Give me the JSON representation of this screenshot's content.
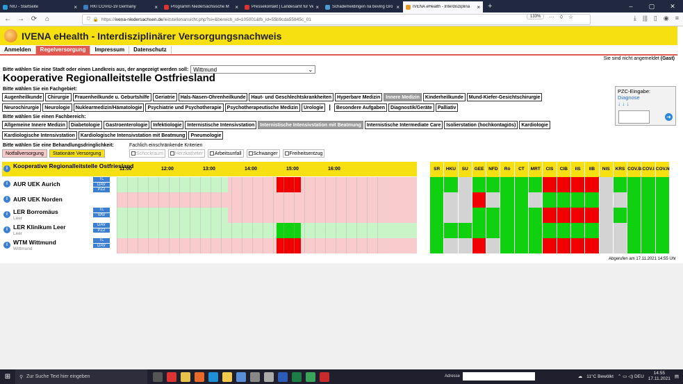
{
  "browser": {
    "tabs": [
      {
        "label": "NIU - Startseite",
        "color": "#2a9bd6",
        "active": false
      },
      {
        "label": "RKI COVID-19 Germany",
        "color": "#3a7fc1",
        "active": false
      },
      {
        "label": "Programm Niedersächsische M",
        "color": "#d33",
        "active": false
      },
      {
        "label": "Pressekontakt | Landesamt für Ve",
        "color": "#d33",
        "active": false
      },
      {
        "label": "Schademeldingen na beving Gro",
        "color": "#4a9bd0",
        "active": false
      },
      {
        "label": "IVENA eHealth - Interdisziplinä",
        "color": "#e89a2a",
        "active": true
      }
    ],
    "url_prefix": "https://",
    "url_host": "ivena-niedersachsen.de",
    "url_path": "/leitstellenansicht.php?si=&bereich_id=105001&fb_id=55b9cda55845c_01",
    "zoom": "133%"
  },
  "app": {
    "title": "IVENA eHealth - Interdisziplinärer Versorgungsnachweis",
    "menu": [
      "Anmelden",
      "Regelversorgung",
      "Impressum",
      "Datenschutz"
    ],
    "login_status_prefix": "Sie sind nicht angemeldet",
    "login_status_user": "(Gast)",
    "city_prompt": "Bitte wählen Sie eine Stadt oder einen Landkreis aus, der angezeigt werden soll:",
    "city_value": "Wittmund",
    "page_title": "Kooperative Regionalleitstelle Ostfriesland",
    "fachgebiet_prompt": "Bitte wählen Sie ein Fachgebiet:",
    "fachgebiete_row1": [
      "Augenheilkunde",
      "Chirurgie",
      "Frauenheilkunde u. Geburtshilfe",
      "Geriatrie",
      "Hals-Nasen-Ohrenheilkunde",
      "Haut- und Geschlechtskrankheiten",
      "Hyperbare Medizin",
      "Innere Medizin",
      "Kinderheilkunde",
      "Mund-Kiefer-Gesichtschirurgie"
    ],
    "fachgebiete_row2": [
      "Neurochirurgie",
      "Neurologie",
      "Nuklearmedizin/Hämatologie",
      "Psychiatrie und Psychotherapie",
      "Psychotherapeutische Medizin",
      "Urologie"
    ],
    "fachgebiete_row2b": [
      "Besondere Aufgaben",
      "Diagnostik/Geräte",
      "Palliativ"
    ],
    "fachgebiet_selected": "Innere Medizin",
    "fachbereich_prompt": "Bitte wählen Sie einen Fachbereich:",
    "fachbereiche_row1": [
      "Allgemeine Innere Medizin",
      "Diabetologie",
      "Gastroenterologie",
      "Infektiologie",
      "Internistische Intensivstation",
      "Internistische Intensivstation mit Beatmung",
      "Internistische Intermediate Care",
      "Isolierstation (hochkontagiös)",
      "Kardiologie"
    ],
    "fachbereiche_row2": [
      "Kardiologische Intensivstation",
      "Kardiologische Intensivstation mit Beatmung",
      "Pneumologie"
    ],
    "fachbereich_selected": "Internistische Intensivstation mit Beatmung",
    "urgency_prompt": "Bitte wählen Sie eine Behandlungsdringlichkeit:",
    "urgency": [
      "Notfallversorgung",
      "Stationäre Versorgung"
    ],
    "criteria_prompt": "Fachlich einschränkende Kriterien",
    "criteria": [
      {
        "label": "Schockraum",
        "enabled": false
      },
      {
        "label": "Herzkatheter",
        "enabled": false
      },
      {
        "label": "Arbeitsunfall",
        "enabled": true
      },
      {
        "label": "Schwanger",
        "enabled": true
      },
      {
        "label": "Freiheitsentzug",
        "enabled": true
      }
    ],
    "pzc_label": "PZC-Eingabe:",
    "pzc_link": "Diagnose",
    "pzc_arrows": "↓ ↓ ↓",
    "table_header": "Kooperative Regionalleitstelle Ostfriesland",
    "time_labels": [
      "11:00",
      "12:00",
      "13:00",
      "14:00",
      "15:00",
      "16:00"
    ],
    "hospitals": [
      {
        "name": "AUR UEK Aurich",
        "sub": "",
        "tags": [
          "TL",
          "DAV",
          "PZ2"
        ]
      },
      {
        "name": "AUR UEK Norden",
        "sub": "",
        "tags": []
      },
      {
        "name": "LER Borromäus",
        "sub": "Leer",
        "tags": [
          "TL",
          "VAV"
        ]
      },
      {
        "name": "LER Klinikum Leer",
        "sub": "Leer",
        "tags": [
          "DAV",
          "PZ2"
        ]
      },
      {
        "name": "WTM Wittmund",
        "sub": "Wittmund",
        "tags": [
          "TL",
          "DAV"
        ]
      }
    ],
    "grid_columns": [
      "SR",
      "HKU",
      "SU",
      "GEE",
      "NFD",
      "Rö",
      "CT",
      "MRT",
      "CIS",
      "CIB",
      "IIS",
      "IIB",
      "NIS",
      "KRS",
      "COV.B",
      "COV.I",
      "COV.N"
    ],
    "grid_status": [
      [
        "g",
        "g",
        "x",
        "g",
        "g",
        "g",
        "g",
        "g",
        "r",
        "r",
        "r",
        "r",
        "x",
        "g",
        "g",
        "g",
        "g"
      ],
      [
        "g",
        "x",
        "x",
        "r",
        "x",
        "g",
        "g",
        "x",
        "g",
        "g",
        "g",
        "g",
        "x",
        "x",
        "g",
        "g",
        "g"
      ],
      [
        "g",
        "x",
        "x",
        "g",
        "g",
        "g",
        "g",
        "g",
        "r",
        "r",
        "r",
        "r",
        "x",
        "g",
        "g",
        "g",
        "g"
      ],
      [
        "g",
        "g",
        "g",
        "g",
        "g",
        "g",
        "g",
        "g",
        "g",
        "g",
        "g",
        "g",
        "x",
        "x",
        "g",
        "g",
        "g"
      ],
      [
        "g",
        "x",
        "x",
        "r",
        "x",
        "g",
        "g",
        "g",
        "r",
        "r",
        "r",
        "r",
        "x",
        "x",
        "g",
        "g",
        "g"
      ]
    ],
    "timestamp": "Abgerufen am 17.11.2021 14:55 Uhr"
  },
  "taskbar": {
    "search_placeholder": "Zur Suche Text hier eingeben",
    "address_label": "Adresse",
    "weather": "11°C Bewölkt",
    "time": "14:55",
    "date": "17.11.2021"
  },
  "colors": {
    "yellow": "#f7e011",
    "green": "#0fd10f",
    "light_green": "#c8f4c8",
    "red": "#f00000",
    "light_red": "#f8cccc",
    "grey": "#d3d3d3",
    "menu_red": "#e0574e"
  }
}
